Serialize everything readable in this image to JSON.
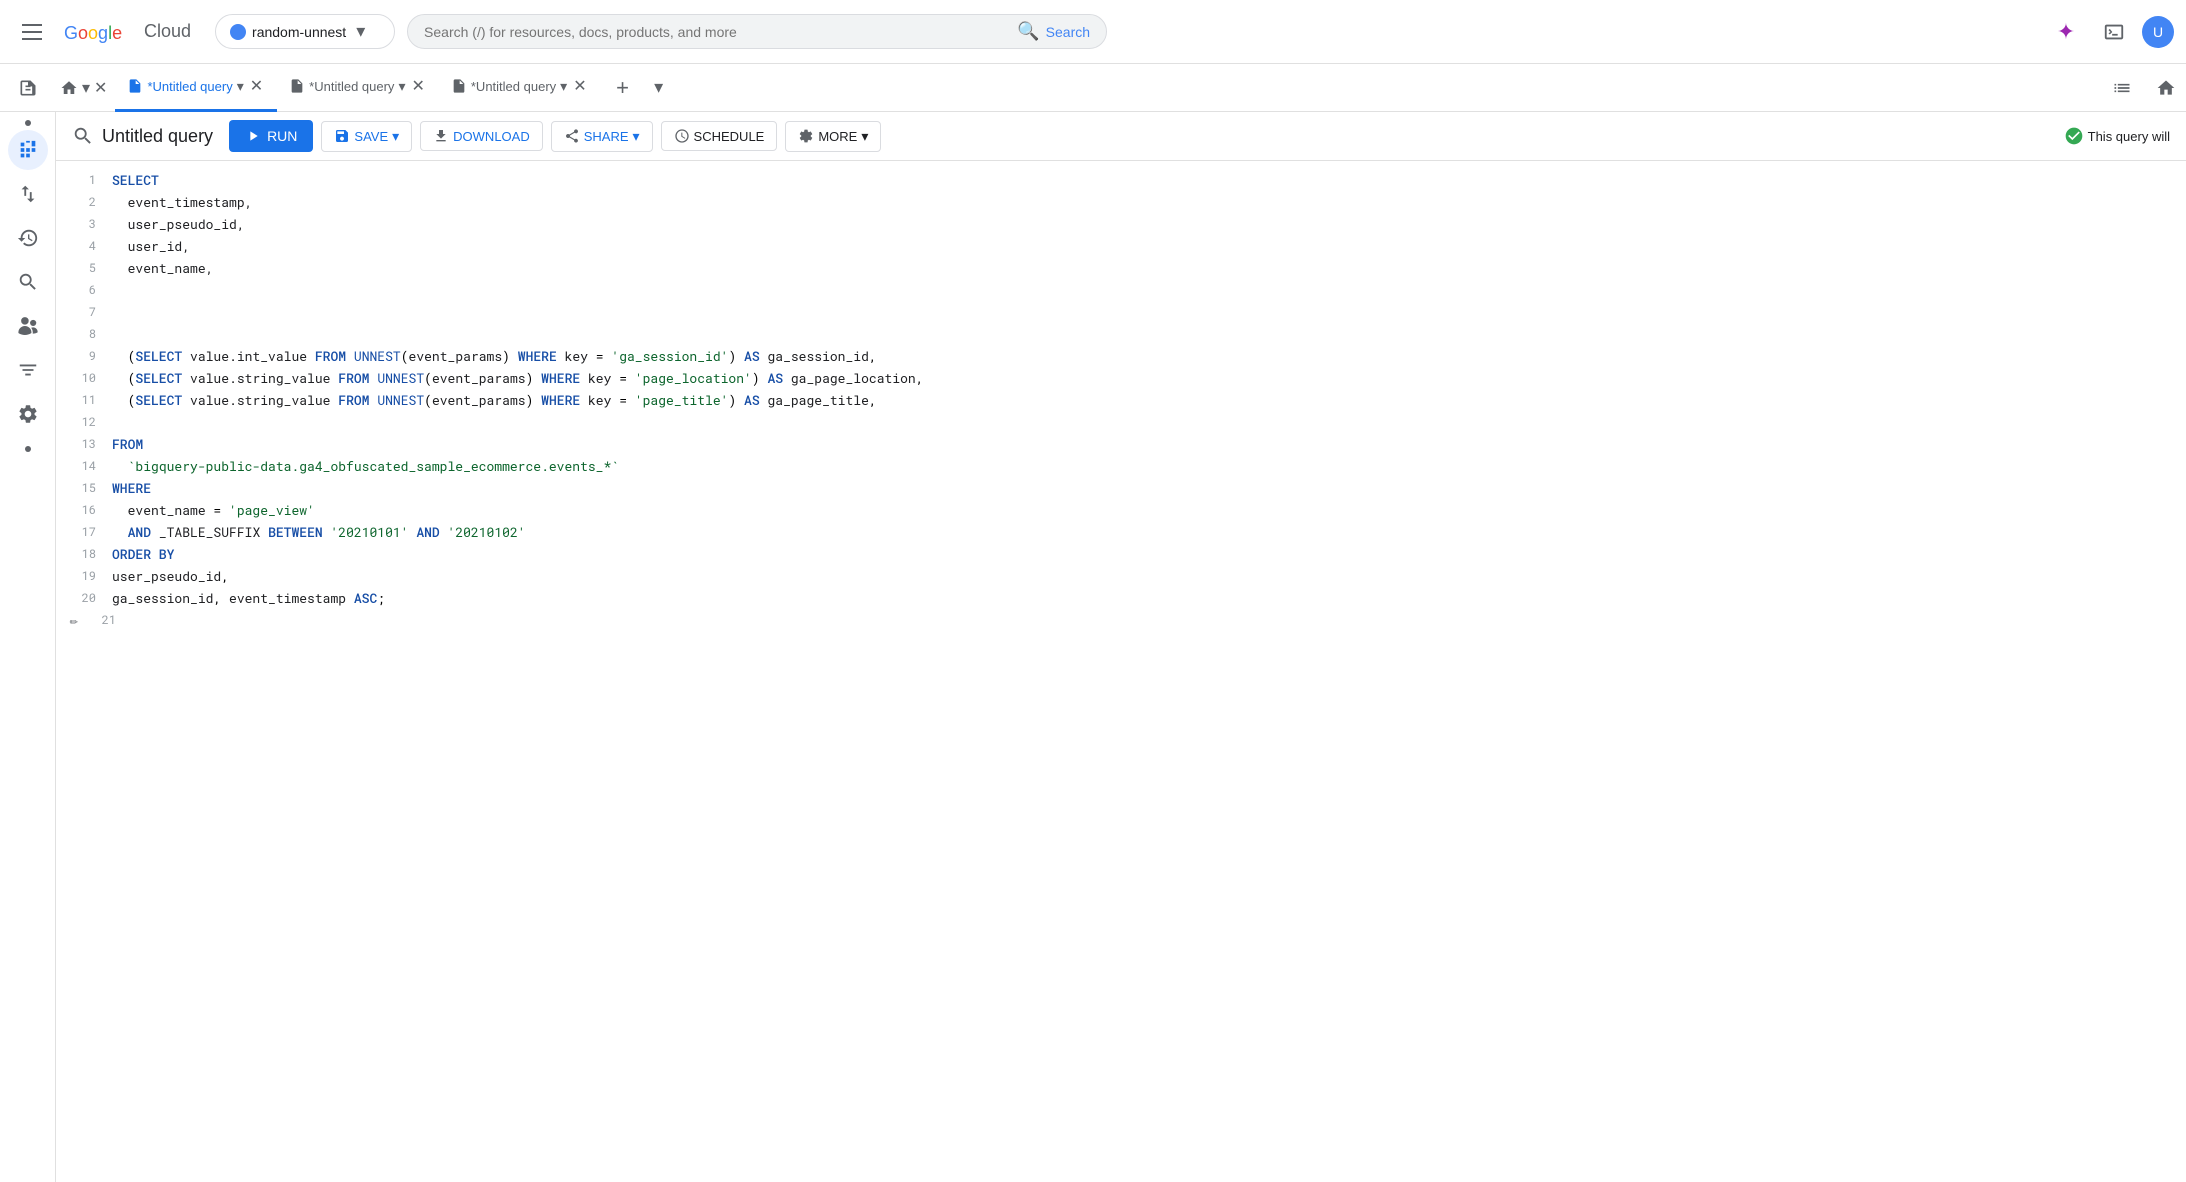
{
  "topnav": {
    "project_name": "random-unnest",
    "search_placeholder": "Search (/) for resources, docs, products, and more",
    "search_btn_label": "Search"
  },
  "tabs": [
    {
      "id": "home",
      "type": "home"
    },
    {
      "id": "tab1",
      "label": "*Untitled query",
      "active": true
    },
    {
      "id": "tab2",
      "label": "*Untitled query",
      "active": false
    },
    {
      "id": "tab3",
      "label": "*Untitled query",
      "active": false
    }
  ],
  "toolbar": {
    "title": "Untitled query",
    "run_label": "RUN",
    "save_label": "SAVE",
    "download_label": "DOWNLOAD",
    "share_label": "SHARE",
    "schedule_label": "SCHEDULE",
    "more_label": "MORE",
    "status_text": "This query will"
  },
  "code": {
    "lines": [
      {
        "num": 1,
        "content": "SELECT",
        "type": "keyword_only"
      },
      {
        "num": 2,
        "content": "  event_timestamp,",
        "type": "field"
      },
      {
        "num": 3,
        "content": "  user_pseudo_id,",
        "type": "field"
      },
      {
        "num": 4,
        "content": "  user_id,",
        "type": "field"
      },
      {
        "num": 5,
        "content": "  event_name,",
        "type": "field"
      },
      {
        "num": 6,
        "content": "",
        "type": "empty"
      },
      {
        "num": 7,
        "content": "",
        "type": "empty"
      },
      {
        "num": 8,
        "content": "",
        "type": "empty"
      },
      {
        "num": 9,
        "content": "  (SELECT value.int_value FROM UNNEST(event_params) WHERE key = 'ga_session_id') AS ga_session_id,",
        "type": "subquery"
      },
      {
        "num": 10,
        "content": "  (SELECT value.string_value FROM UNNEST(event_params) WHERE key = 'page_location') AS ga_page_location,",
        "type": "subquery"
      },
      {
        "num": 11,
        "content": "  (SELECT value.string_value FROM UNNEST(event_params) WHERE key = 'page_title') AS ga_page_title,",
        "type": "subquery"
      },
      {
        "num": 12,
        "content": "",
        "type": "empty"
      },
      {
        "num": 13,
        "content": "FROM",
        "type": "keyword_only"
      },
      {
        "num": 14,
        "content": "  `bigquery-public-data.ga4_obfuscated_sample_ecommerce.events_*`",
        "type": "table"
      },
      {
        "num": 15,
        "content": "WHERE",
        "type": "keyword_only"
      },
      {
        "num": 16,
        "content": "  event_name = 'page_view'",
        "type": "where_clause"
      },
      {
        "num": 17,
        "content": "  AND _TABLE_SUFFIX BETWEEN '20210101' AND '20210102'",
        "type": "and_clause"
      },
      {
        "num": 18,
        "content": "ORDER BY",
        "type": "keyword_only"
      },
      {
        "num": 19,
        "content": "user_pseudo_id,",
        "type": "field_noindent"
      },
      {
        "num": 20,
        "content": "ga_session_id, event_timestamp ASC;",
        "type": "orderby_asc"
      },
      {
        "num": 21,
        "content": "",
        "type": "empty_edit"
      }
    ]
  }
}
